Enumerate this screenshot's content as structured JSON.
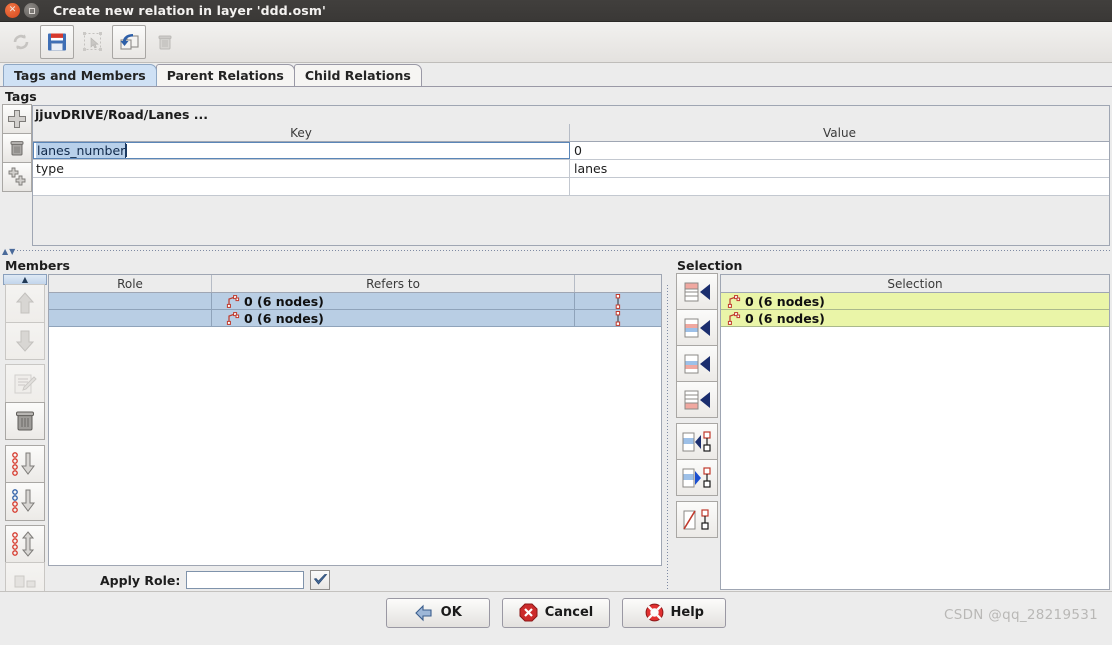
{
  "window": {
    "title": "Create new relation in layer 'ddd.osm'",
    "close_icon": "window-close-icon",
    "maximize_icon": "window-maximize-icon"
  },
  "toolbar": {
    "buttons": [
      {
        "name": "refresh-button",
        "icon": "refresh-icon",
        "enabled": false
      },
      {
        "name": "save-button",
        "icon": "floppy-disk-icon",
        "enabled": true
      },
      {
        "name": "select-button",
        "icon": "selection-pointer-icon",
        "enabled": false
      },
      {
        "name": "duplicate-relation-button",
        "icon": "copy-relation-icon",
        "enabled": true
      },
      {
        "name": "delete-button",
        "icon": "trash-icon",
        "enabled": false
      }
    ]
  },
  "tabs": [
    {
      "label": "Tags and Members",
      "active": true
    },
    {
      "label": "Parent Relations",
      "active": false
    },
    {
      "label": "Child Relations",
      "active": false
    }
  ],
  "tags": {
    "section_label": "Tags",
    "preset_title": "jjuvDRIVE/Road/Lanes ...",
    "columns": [
      "Key",
      "Value"
    ],
    "rows": [
      {
        "key": "lanes_number",
        "value": "0",
        "editing": true
      },
      {
        "key": "type",
        "value": "lanes",
        "editing": false
      },
      {
        "key": "",
        "value": "",
        "editing": false
      }
    ],
    "side_buttons": [
      {
        "name": "add-tag-button",
        "icon": "plus-icon"
      },
      {
        "name": "delete-tag-button",
        "icon": "trash-icon"
      },
      {
        "name": "paste-tags-button",
        "icon": "paste-tags-icon"
      }
    ]
  },
  "members": {
    "section_label": "Members",
    "columns": [
      "Role",
      "Refers to",
      ""
    ],
    "rows": [
      {
        "role": "",
        "refers_to": "0 (6 nodes)",
        "icon": "way-icon",
        "link_icon": "segment-icon",
        "selected": true
      },
      {
        "role": "",
        "refers_to": "0 (6 nodes)",
        "icon": "way-icon",
        "link_icon": "segment-icon",
        "selected": true
      }
    ],
    "side_buttons": [
      {
        "name": "move-up-button",
        "icon": "arrow-up-icon",
        "enabled": false
      },
      {
        "name": "move-down-button",
        "icon": "arrow-down-icon",
        "enabled": false
      },
      {
        "name": "edit-member-button",
        "icon": "edit-icon",
        "enabled": false
      },
      {
        "name": "remove-member-button",
        "icon": "trash-icon",
        "enabled": true
      },
      {
        "name": "sort-members-button",
        "icon": "sort-down-icon",
        "enabled": true
      },
      {
        "name": "sort-below-button",
        "icon": "sort-below-icon",
        "enabled": true
      },
      {
        "name": "reverse-members-button",
        "icon": "reverse-updown-icon",
        "enabled": true
      }
    ],
    "scroll_up_icon": "scroll-up-icon",
    "scroll_down_icon": "scroll-down-icon"
  },
  "apply_role": {
    "label": "Apply Role:",
    "value": "",
    "confirm_icon": "checkmark-icon"
  },
  "selection": {
    "section_label": "Selection",
    "column": "Selection",
    "rows": [
      {
        "label": "0 (6 nodes)",
        "icon": "way-icon"
      },
      {
        "label": "0 (6 nodes)",
        "icon": "way-icon"
      }
    ],
    "side_buttons": [
      {
        "name": "add-all-to-end-button",
        "icon": "add-selection-top-icon"
      },
      {
        "name": "add-selection-middle-button",
        "icon": "add-selection-middle-icon"
      },
      {
        "name": "add-selection-below-button",
        "icon": "add-selection-below-icon"
      },
      {
        "name": "add-all-bottom-button",
        "icon": "add-selection-bottom-icon"
      },
      {
        "name": "select-members-button",
        "icon": "select-members-icon"
      },
      {
        "name": "select-in-map-button",
        "icon": "select-map-icon"
      },
      {
        "name": "remove-selected-button",
        "icon": "cancel-selection-icon"
      }
    ]
  },
  "footer": {
    "ok_label": "OK",
    "ok_icon": "ok-arrow-icon",
    "cancel_label": "Cancel",
    "cancel_icon": "cancel-octagon-icon",
    "help_label": "Help",
    "help_icon": "lifebuoy-icon"
  },
  "watermark": "CSDN @qq_28219531",
  "colors": {
    "titlebar": "#3d3b39",
    "tab_active": "#cfe1f5",
    "member_row": "#b9cee4",
    "selection_row": "#eaf5a8",
    "text_selection": "#b8d0ea"
  }
}
